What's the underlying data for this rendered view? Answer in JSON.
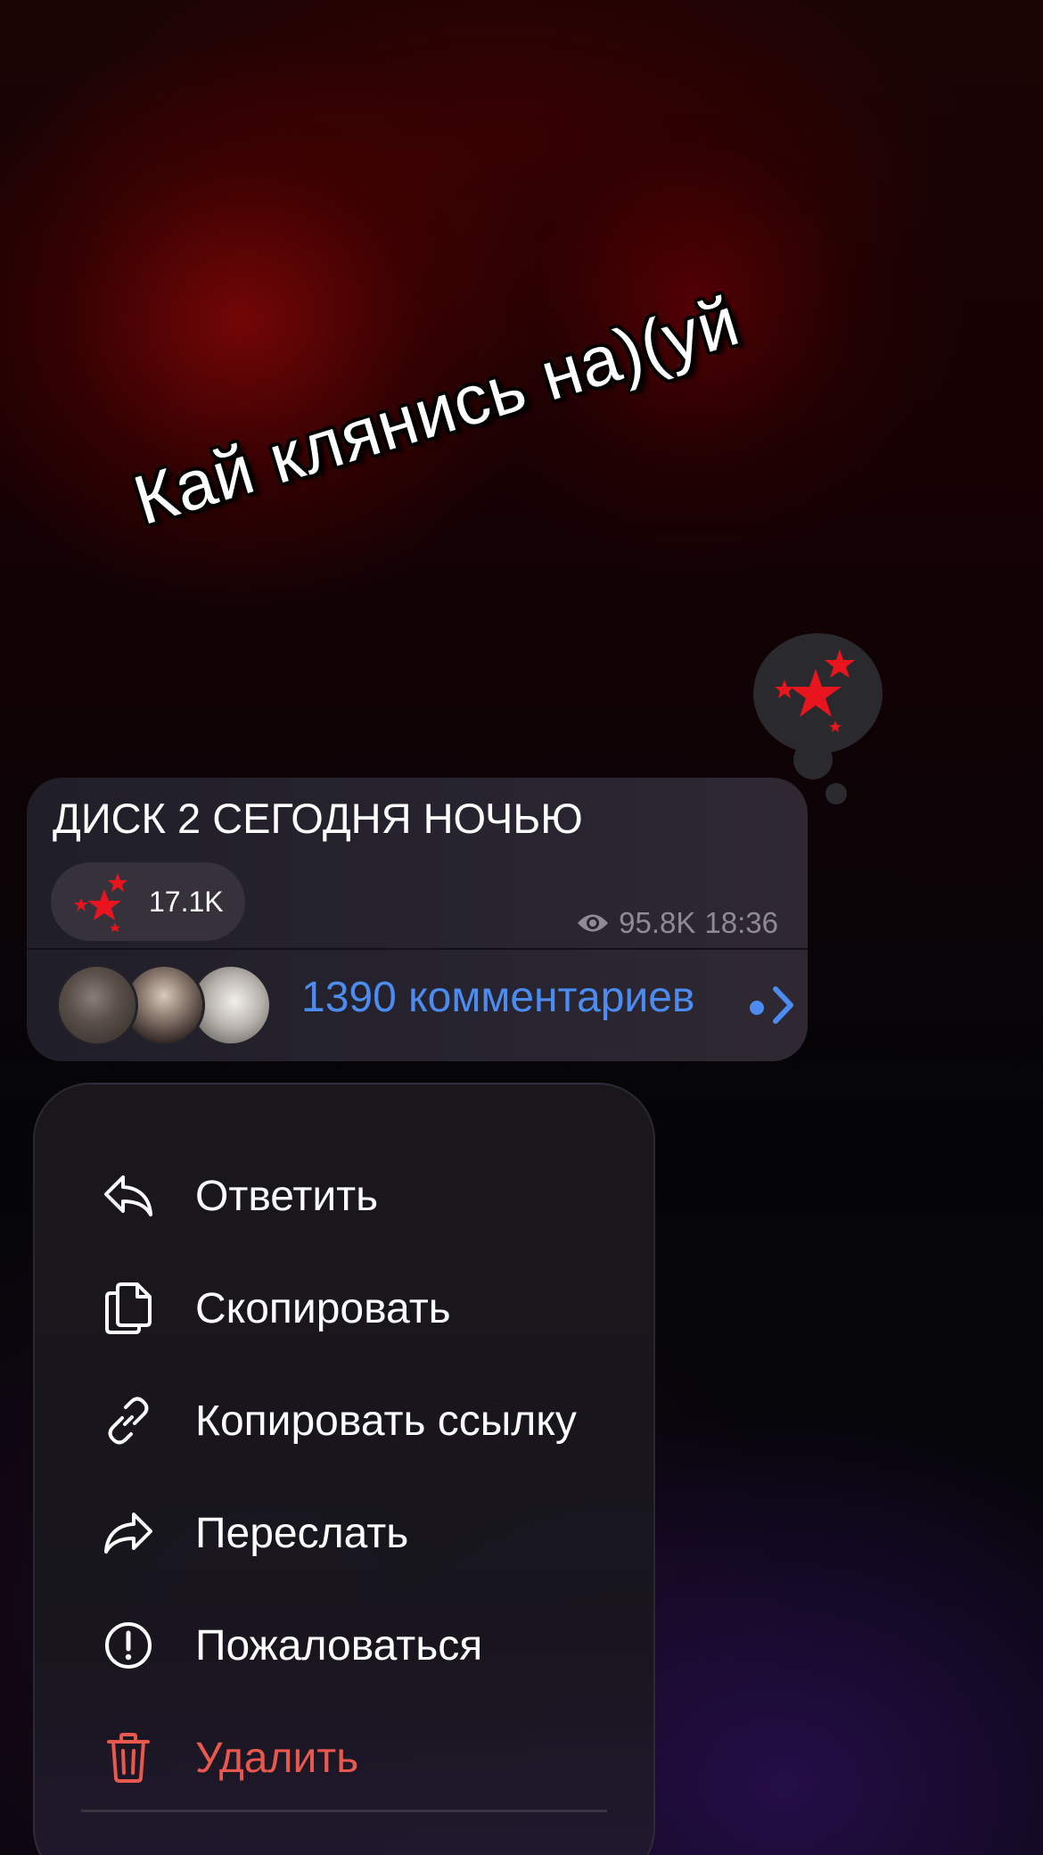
{
  "sticker": {
    "text": "Кай клянись на)(уй"
  },
  "message": {
    "text": "ДИСК 2 СЕГОДНЯ НОЧЬЮ",
    "reaction": {
      "icon": "red-stars-icon",
      "count": "17.1K"
    },
    "views": "95.8K",
    "time": "18:36",
    "comments": {
      "label": "1390 комментариев",
      "avatars": [
        "avatar-1",
        "avatar-2",
        "avatar-3"
      ]
    }
  },
  "context_menu": {
    "items": [
      {
        "label": "Ответить",
        "icon": "reply-icon"
      },
      {
        "label": "Скопировать",
        "icon": "copy-icon"
      },
      {
        "label": "Копировать ссылку",
        "icon": "link-icon"
      },
      {
        "label": "Переслать",
        "icon": "forward-icon"
      },
      {
        "label": "Пожаловаться",
        "icon": "report-icon"
      },
      {
        "label": "Удалить",
        "icon": "trash-icon"
      }
    ]
  },
  "colors": {
    "accent_blue": "#4c8cf1",
    "danger_red": "#e8584d",
    "reaction_red": "#e8141e"
  }
}
